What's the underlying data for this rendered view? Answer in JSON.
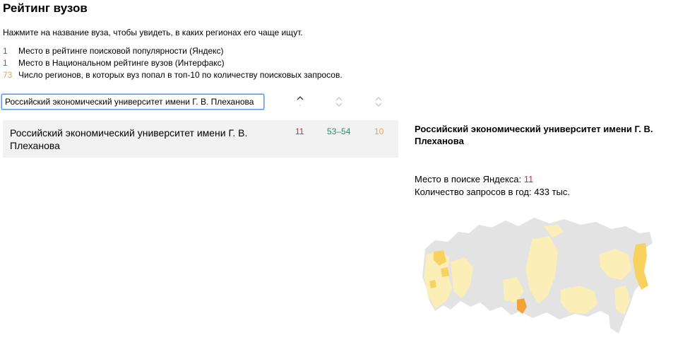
{
  "page": {
    "title": "Рейтинг вузов",
    "intro": "Нажмите на название вуза, чтобы увидеть, в каких регионах его чаще ищут."
  },
  "legend": [
    {
      "num": "1",
      "text": "Место в рейтинге поисковой популярности (Яндекс)",
      "color": "#e32636"
    },
    {
      "num": "1",
      "text": "Место в Национальном рейтинге вузов (Интерфакс)",
      "color": "#2e8b66"
    },
    {
      "num": "73",
      "text": "Число регионов, в которых вуз попал в топ-10 по количеству поисковых запросов.",
      "color": "#f0a04b"
    }
  ],
  "search": {
    "value": "Российский экономический университет имени Г. В. Плеханова"
  },
  "results": [
    {
      "name": "Российский экономический университет имени Г. В. Плеханова",
      "yandex_rank": "11",
      "interfax_rank": "53–54",
      "regions": "10"
    }
  ],
  "detail": {
    "title": "Российский экономический университет имени Г. В. Плеханова",
    "yandex_label": "Место в поиске Яндекса:",
    "yandex_value": "11",
    "queries_label": "Количество запросов в год:",
    "queries_value": "433 тыс."
  },
  "colors": {
    "red": "#e32636",
    "green": "#2e8b66",
    "orange": "#f0a04b",
    "map_base": "#e3e3e3",
    "map_light": "#fbeeb6",
    "map_medium": "#f7d25e",
    "map_strong": "#f2a33a"
  }
}
